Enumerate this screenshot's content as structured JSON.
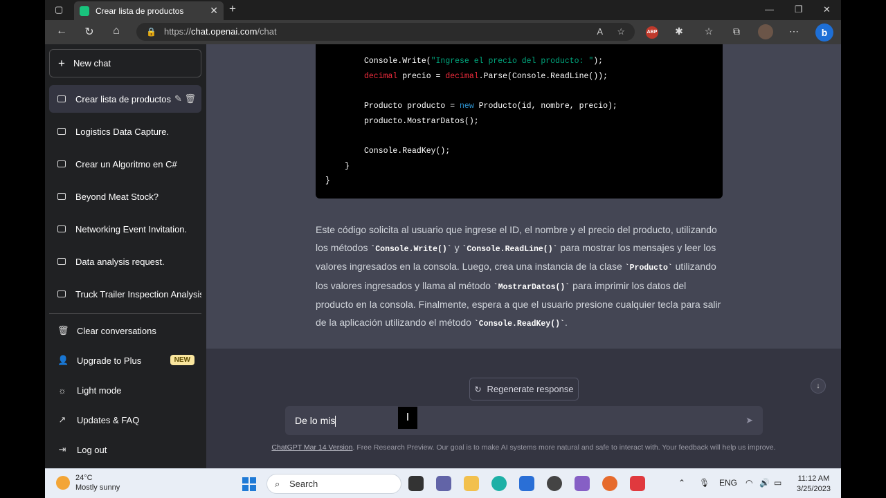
{
  "browser": {
    "tab_title": "Crear lista de productos",
    "url_scheme": "https://",
    "url_host": "chat.openai.com",
    "url_path": "/chat",
    "abp_label": "ABP"
  },
  "sidebar": {
    "new_chat": "New chat",
    "conversations": [
      {
        "label": "Crear lista de productos",
        "active": true
      },
      {
        "label": "Logistics Data Capture.",
        "active": false
      },
      {
        "label": "Crear un Algoritmo en C#",
        "active": false
      },
      {
        "label": "Beyond Meat Stock?",
        "active": false
      },
      {
        "label": "Networking Event Invitation.",
        "active": false
      },
      {
        "label": "Data analysis request.",
        "active": false
      },
      {
        "label": "Truck Trailer Inspection Analysis",
        "active": false
      }
    ],
    "menu": {
      "clear": "Clear conversations",
      "upgrade": "Upgrade to Plus",
      "upgrade_badge": "NEW",
      "light_mode": "Light mode",
      "updates": "Updates & FAQ",
      "logout": "Log out"
    }
  },
  "code": {
    "l1_a": "Console.Write(",
    "l1_str": "\"Ingrese el precio del producto: \"",
    "l1_b": ");",
    "l2_kw": "decimal",
    "l2_a": " precio = ",
    "l2_kw2": "decimal",
    "l2_b": ".Parse(Console.ReadLine());",
    "l3_a": "Producto producto = ",
    "l3_kw": "new",
    "l3_b": " Producto(id, nombre, precio);",
    "l4": "producto.MostrarDatos();",
    "l5": "Console.ReadKey();",
    "l6": "}",
    "l7": "}"
  },
  "answer": {
    "t1": "Este código solicita al usuario que ingrese el ID, el nombre y el precio del producto, utilizando los métodos ",
    "c1": "`Console.Write()`",
    "t2": " y ",
    "c2": "`Console.ReadLine()`",
    "t3": " para mostrar los mensajes y leer los valores ingresados en la consola. Luego, crea una instancia de la clase ",
    "c3": "`Producto`",
    "t4": " utilizando los valores ingresados y llama al método ",
    "c4": "`MostrarDatos()`",
    "t5": " para imprimir los datos del producto en la consola. Finalmente, espera a que el usuario presione cualquier tecla para salir de la aplicación utilizando el método ",
    "c5": "`Console.ReadKey()`",
    "t6": "."
  },
  "composer": {
    "regenerate": "Regenerate response",
    "input_value": "De lo mis",
    "footer_link": "ChatGPT Mar 14 Version",
    "footer_text": ". Free Research Preview. Our goal is to make AI systems more natural and safe to interact with. Your feedback will help us improve."
  },
  "taskbar": {
    "temp": "24°C",
    "weather": "Mostly sunny",
    "search": "Search",
    "lang": "ENG",
    "time": "11:12 AM",
    "date": "3/25/2023"
  }
}
